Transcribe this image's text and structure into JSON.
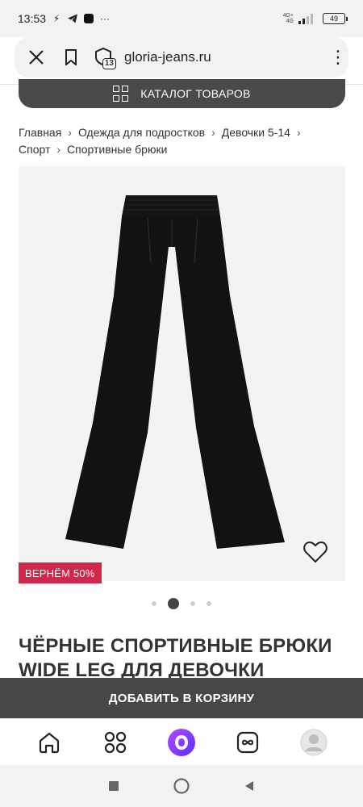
{
  "status_bar": {
    "time": "13:53",
    "network_top": "4G+",
    "network_bottom": "4G",
    "battery": "49"
  },
  "browser": {
    "url": "gloria-jeans.ru",
    "tab_count": "13"
  },
  "catalog_button": {
    "label": "КАТАЛОГ ТОВАРОВ"
  },
  "breadcrumbs": [
    "Главная",
    "Одежда для подростков",
    "Девочки 5-14",
    "Спорт",
    "Спортивные брюки"
  ],
  "product": {
    "promo_badge": "ВЕРНЁМ 50%",
    "title": "ЧЁРНЫЕ СПОРТИВНЫЕ БРЮКИ WIDE LEG ДЛЯ ДЕВОЧКИ",
    "gallery": {
      "slides": 4,
      "active_index": 1
    }
  },
  "add_to_cart": {
    "label": "ДОБАВИТЬ В КОРЗИНУ"
  },
  "bottom_nav": [
    "home-icon",
    "catalog-icon",
    "alice-icon",
    "loyalty-icon",
    "profile-icon"
  ],
  "colors": {
    "accent_badge": "#d2264a",
    "dark_button": "#474747",
    "alice": "#8a3ffc"
  }
}
